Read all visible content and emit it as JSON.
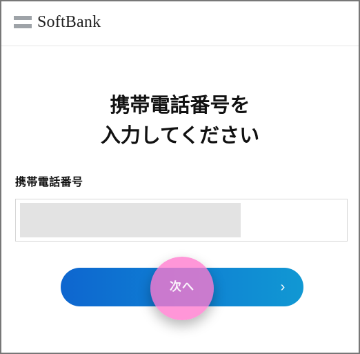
{
  "header": {
    "brand": "SoftBank"
  },
  "main": {
    "title_line1": "携帯電話番号を",
    "title_line2": "入力してください",
    "field_label": "携帯電話番号",
    "field_value": "",
    "next_button": "次へ",
    "next_icon": "chevron-right-icon"
  },
  "colors": {
    "button_gradient_start": "#0e66cf",
    "button_gradient_end": "#1198d3",
    "tap_indicator": "#ff78cd"
  }
}
